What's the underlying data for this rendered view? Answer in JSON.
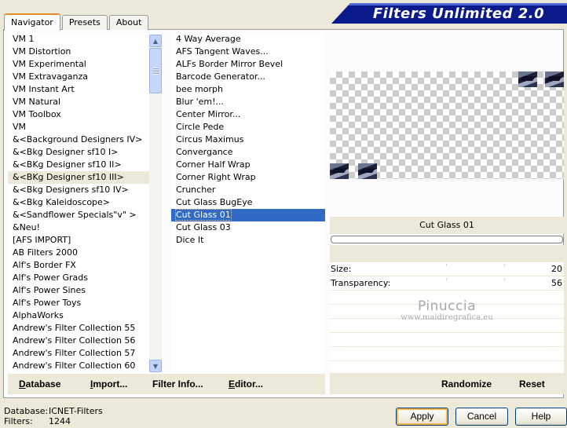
{
  "window": {
    "title": "Filters Unlimited 2.0"
  },
  "tabs": [
    {
      "label": "Navigator",
      "active": true
    },
    {
      "label": "Presets",
      "active": false
    },
    {
      "label": "About",
      "active": false
    }
  ],
  "categories": {
    "hovered_index": 11,
    "items": [
      "VM 1",
      "VM Distortion",
      "VM Experimental",
      "VM Extravaganza",
      "VM Instant Art",
      "VM Natural",
      "VM Toolbox",
      "VM",
      "&<Background Designers IV>",
      "&<Bkg Designer sf10 I>",
      "&<BKg Designer sf10 II>",
      "&<BKg Designer sf10 III>",
      "&<Bkg Designers sf10 IV>",
      "&<Bkg Kaleidoscope>",
      "&<Sandflower Specials\"v\" >",
      "&Neu!",
      "[AFS IMPORT]",
      "AB Filters 2000",
      "Alf's Border FX",
      "Alf's Power Grads",
      "Alf's Power Sines",
      "Alf's Power Toys",
      "AlphaWorks",
      "Andrew's Filter Collection 55",
      "Andrew's Filter Collection 56",
      "Andrew's Filter Collection 57",
      "Andrew's Filter Collection 60"
    ]
  },
  "filters": {
    "selected_index": 14,
    "items": [
      "4 Way Average",
      "AFS Tangent Waves...",
      "ALFs Border Mirror Bevel",
      "Barcode Generator...",
      "bee morph",
      "Blur 'em!...",
      "Center Mirror...",
      "Circle Pede",
      "Circus Maximus",
      "Convergance",
      "Corner Half Wrap",
      "Corner Right Wrap",
      "Cruncher",
      "Cut Glass  BugEye",
      "Cut Glass 01",
      "Cut Glass 03",
      "Dice It"
    ]
  },
  "left_buttons": [
    {
      "name": "database-button",
      "label": "Database",
      "underline": "D",
      "rest": "atabase"
    },
    {
      "name": "import-button",
      "label": "Import...",
      "underline": "I",
      "rest": "mport..."
    },
    {
      "name": "filter-info-button",
      "label": "Filter Info...",
      "underline": "",
      "rest": "Filter Info..."
    },
    {
      "name": "editor-button",
      "label": "Editor...",
      "underline": "E",
      "rest": "ditor..."
    }
  ],
  "preview": {
    "selected_filter": "Cut Glass 01",
    "progress": 0
  },
  "parameters": [
    {
      "label": "Size:",
      "value": "20"
    },
    {
      "label": "Transparency:",
      "value": "56"
    }
  ],
  "watermark": {
    "name": "Pinuccia",
    "url": "www.maidiregrafica.eu"
  },
  "right_buttons": {
    "randomize": "Randomize",
    "reset": "Reset"
  },
  "footer": {
    "database_label": "Database:",
    "database_value": "ICNET-Filters",
    "filters_label": "Filters:",
    "filters_value": "1244"
  },
  "dialog_buttons": {
    "apply": "Apply",
    "cancel": "Cancel",
    "help": "Help"
  }
}
